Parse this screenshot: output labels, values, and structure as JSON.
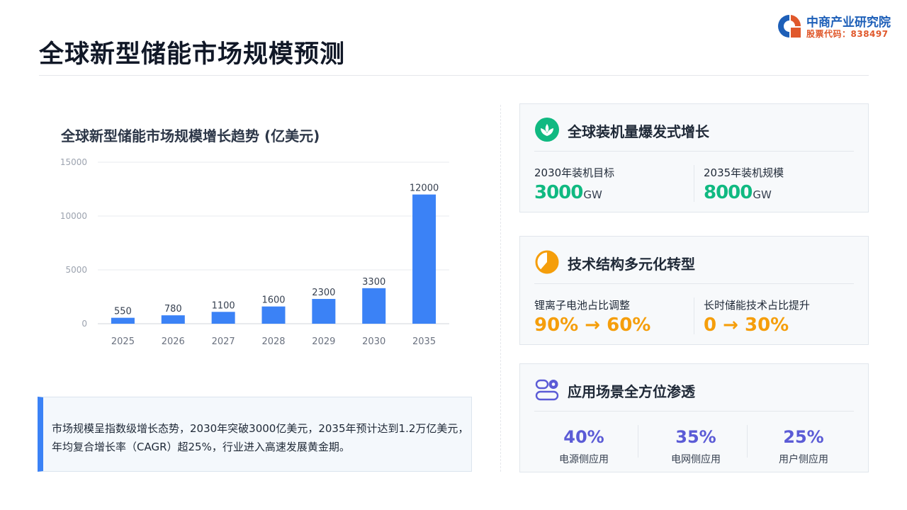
{
  "page": {
    "title": "全球新型储能市场规模预测"
  },
  "logo": {
    "name": "中商产业研究院",
    "code": "股票代码：838497"
  },
  "chart_data": {
    "type": "bar",
    "title": "全球新型储能市场规模增长趋势 (亿美元)",
    "categories": [
      "2025",
      "2026",
      "2027",
      "2028",
      "2029",
      "2030",
      "2035"
    ],
    "values": [
      550,
      780,
      1100,
      1600,
      2300,
      3300,
      12000
    ],
    "ylim": [
      0,
      15000
    ],
    "yticks": [
      0,
      5000,
      10000,
      15000
    ],
    "grid": true,
    "bar_color": "#3b82f6"
  },
  "note": {
    "text": "市场规模呈指数级增长态势，2030年突破3000亿美元，2035年预计达到1.2万亿美元，年均复合增长率（CAGR）超25%，行业进入高速发展黄金期。"
  },
  "cards": {
    "install": {
      "title": "全球装机量爆发式增长",
      "icon": "sprout-icon",
      "accent": "#10b981",
      "left_label": "2030年装机目标",
      "left_value": "3000",
      "left_unit": "GW",
      "right_label": "2035年装机规模",
      "right_value": "8000",
      "right_unit": "GW"
    },
    "tech": {
      "title": "技术结构多元化转型",
      "icon": "pie-chart-icon",
      "accent": "#f59e0b",
      "left_label": "锂离子电池占比调整",
      "left_value": "90% → 60%",
      "right_label": "长时储能技术占比提升",
      "right_value": "0 → 30%"
    },
    "apps": {
      "title": "应用场景全方位渗透",
      "icon": "toggle-settings-icon",
      "accent": "#5b5bd6",
      "items": [
        {
          "value": "40%",
          "label": "电源侧应用"
        },
        {
          "value": "35%",
          "label": "电网侧应用"
        },
        {
          "value": "25%",
          "label": "用户侧应用"
        }
      ]
    }
  }
}
